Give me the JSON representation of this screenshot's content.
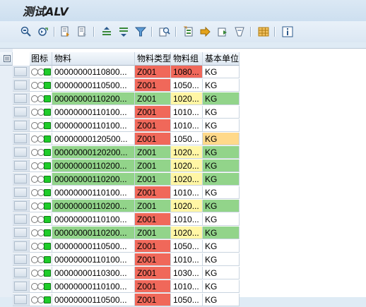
{
  "window": {
    "title": "测试ALV"
  },
  "toolbar": {
    "buttons": [
      {
        "name": "details-icon"
      },
      {
        "name": "refresh-icon"
      },
      {
        "name": "check-icon"
      },
      {
        "name": "check-alt-icon"
      },
      {
        "name": "sort-ascending-icon"
      },
      {
        "name": "sort-descending-icon"
      },
      {
        "name": "filter-icon"
      },
      {
        "name": "find-icon"
      },
      {
        "name": "print-preview-icon"
      },
      {
        "name": "export-icon"
      },
      {
        "name": "send-icon"
      },
      {
        "name": "abc-analysis-icon"
      },
      {
        "name": "layout-icon"
      },
      {
        "name": "info-icon"
      }
    ]
  },
  "grid": {
    "columns": [
      "图标",
      "物料",
      "物料类型",
      "物料组",
      "基本单位"
    ],
    "rows": [
      {
        "material": "00000000110800...",
        "type": "Z001",
        "group": "1080...",
        "uom": "KG",
        "color": "white",
        "typeColor": "red",
        "groupColor": "red",
        "uomColor": "white"
      },
      {
        "material": "00000000110500...",
        "type": "Z001",
        "group": "1050...",
        "uom": "KG",
        "color": "white",
        "typeColor": "red",
        "groupColor": "white",
        "uomColor": "white"
      },
      {
        "material": "00000000110200...",
        "type": "Z001",
        "group": "1020...",
        "uom": "KG",
        "color": "green",
        "typeColor": "green",
        "groupColor": "yellow",
        "uomColor": "green"
      },
      {
        "material": "00000000110100...",
        "type": "Z001",
        "group": "1010...",
        "uom": "KG",
        "color": "white",
        "typeColor": "red",
        "groupColor": "white",
        "uomColor": "white"
      },
      {
        "material": "00000000110100...",
        "type": "Z001",
        "group": "1010...",
        "uom": "KG",
        "color": "white",
        "typeColor": "red",
        "groupColor": "white",
        "uomColor": "white"
      },
      {
        "material": "00000000120500...",
        "type": "Z001",
        "group": "1050...",
        "uom": "KG",
        "color": "white",
        "typeColor": "red",
        "groupColor": "white",
        "uomColor": "orange"
      },
      {
        "material": "00000000120200...",
        "type": "Z001",
        "group": "1020...",
        "uom": "KG",
        "color": "green",
        "typeColor": "green",
        "groupColor": "yellow",
        "uomColor": "green"
      },
      {
        "material": "00000000110200...",
        "type": "Z001",
        "group": "1020...",
        "uom": "KG",
        "color": "green",
        "typeColor": "green",
        "groupColor": "yellow",
        "uomColor": "green"
      },
      {
        "material": "00000000110200...",
        "type": "Z001",
        "group": "1020...",
        "uom": "KG",
        "color": "green",
        "typeColor": "green",
        "groupColor": "yellow",
        "uomColor": "green"
      },
      {
        "material": "00000000110100...",
        "type": "Z001",
        "group": "1010...",
        "uom": "KG",
        "color": "white",
        "typeColor": "red",
        "groupColor": "white",
        "uomColor": "white"
      },
      {
        "material": "00000000110200...",
        "type": "Z001",
        "group": "1020...",
        "uom": "KG",
        "color": "green",
        "typeColor": "green",
        "groupColor": "yellow",
        "uomColor": "green"
      },
      {
        "material": "00000000110100...",
        "type": "Z001",
        "group": "1010...",
        "uom": "KG",
        "color": "white",
        "typeColor": "red",
        "groupColor": "white",
        "uomColor": "white"
      },
      {
        "material": "00000000110200...",
        "type": "Z001",
        "group": "1020...",
        "uom": "KG",
        "color": "green",
        "typeColor": "green",
        "groupColor": "yellow",
        "uomColor": "green"
      },
      {
        "material": "00000000110500...",
        "type": "Z001",
        "group": "1050...",
        "uom": "KG",
        "color": "white",
        "typeColor": "red",
        "groupColor": "white",
        "uomColor": "white"
      },
      {
        "material": "00000000110100...",
        "type": "Z001",
        "group": "1010...",
        "uom": "KG",
        "color": "white",
        "typeColor": "red",
        "groupColor": "white",
        "uomColor": "white"
      },
      {
        "material": "00000000110300...",
        "type": "Z001",
        "group": "1030...",
        "uom": "KG",
        "color": "white",
        "typeColor": "red",
        "groupColor": "white",
        "uomColor": "white"
      },
      {
        "material": "00000000110100...",
        "type": "Z001",
        "group": "1010...",
        "uom": "KG",
        "color": "white",
        "typeColor": "red",
        "groupColor": "white",
        "uomColor": "white"
      },
      {
        "material": "00000000110500...",
        "type": "Z001",
        "group": "1050...",
        "uom": "KG",
        "color": "white",
        "typeColor": "red",
        "groupColor": "white",
        "uomColor": "white"
      }
    ]
  },
  "colors": {
    "green": "#92d48a",
    "red": "#f0685a",
    "yellow": "#fff6a5",
    "orange": "#ffd98a",
    "header_bg": "#dfebf5"
  }
}
